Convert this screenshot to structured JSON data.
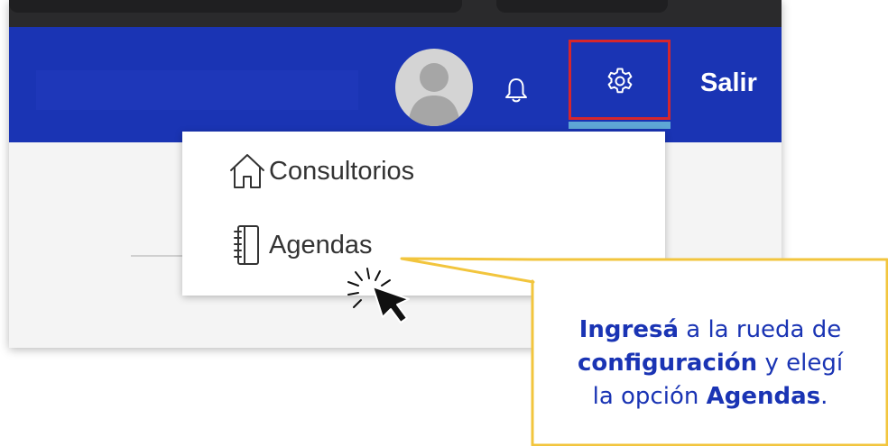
{
  "navbar": {
    "logout_label": "Salir"
  },
  "dropdown": {
    "items": [
      {
        "label": "Consultorios",
        "icon": "home-icon"
      },
      {
        "label": "Agendas",
        "icon": "notebook-icon"
      }
    ]
  },
  "callout": {
    "line1_bold": "Ingresá",
    "line1_rest": " a la rueda de",
    "line2_bold": "configuración",
    "line2_rest": " y elegí",
    "line3_start": "la opción ",
    "line3_bold": "Agendas",
    "line3_end": "."
  },
  "colors": {
    "navbar": "#1a34b4",
    "highlight_border": "#d6262c",
    "active_underline": "#5ea6d6",
    "callout_border": "#f2c53d",
    "callout_text": "#1a34b4"
  }
}
